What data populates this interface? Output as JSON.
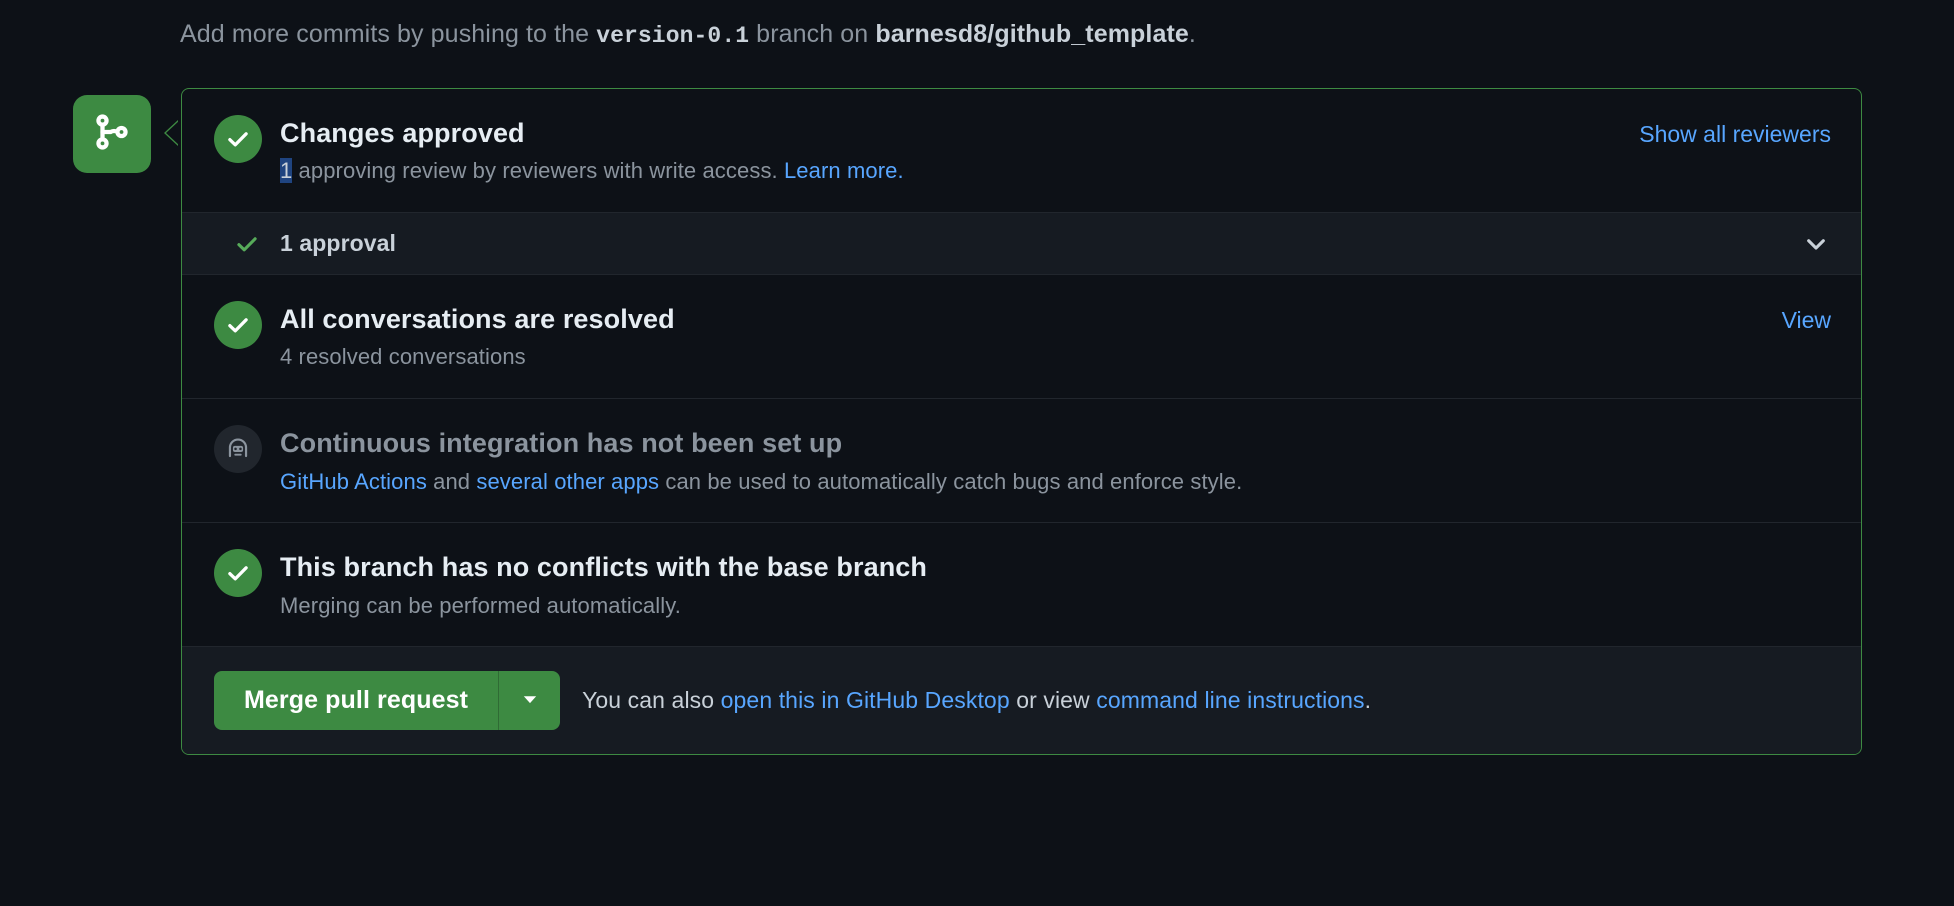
{
  "header": {
    "prefix": "Add more commits by pushing to the ",
    "branch": "version-0.1",
    "middle": " branch on ",
    "repo": "barnesd8/github_template",
    "suffix": "."
  },
  "state_icon": "git-branch-icon",
  "sections": {
    "approved": {
      "icon": "check-circle-icon",
      "title": "Changes approved",
      "sub_selected": "1",
      "sub_rest": " approving review by reviewers with write access. ",
      "sub_link": "Learn more.",
      "action_label": "Show all reviewers"
    },
    "approval_row": {
      "icon": "check-icon",
      "label": "1 approval",
      "toggle_icon": "chevron-down-icon"
    },
    "conversations": {
      "icon": "check-circle-icon",
      "title": "All conversations are resolved",
      "sub": "4 resolved conversations",
      "action_label": "View"
    },
    "ci": {
      "icon": "robot-icon",
      "title": "Continuous integration has not been set up",
      "sub_link1": "GitHub Actions",
      "sub_mid": " and ",
      "sub_link2": "several other apps",
      "sub_rest": " can be used to automatically catch bugs and enforce style."
    },
    "conflicts": {
      "icon": "check-circle-icon",
      "title": "This branch has no conflicts with the base branch",
      "sub": "Merging can be performed automatically."
    }
  },
  "footer": {
    "merge_label": "Merge pull request",
    "caret_icon": "triangle-down-icon",
    "note_prefix": "You can also ",
    "note_link1": "open this in GitHub Desktop",
    "note_mid": " or view ",
    "note_link2": "command line instructions",
    "note_suffix": "."
  },
  "colors": {
    "green": "#3d8a42",
    "link_blue": "#58a6ff",
    "background": "#0d1117",
    "panel_alt": "#161b22",
    "selection_blue": "#1f4480"
  }
}
